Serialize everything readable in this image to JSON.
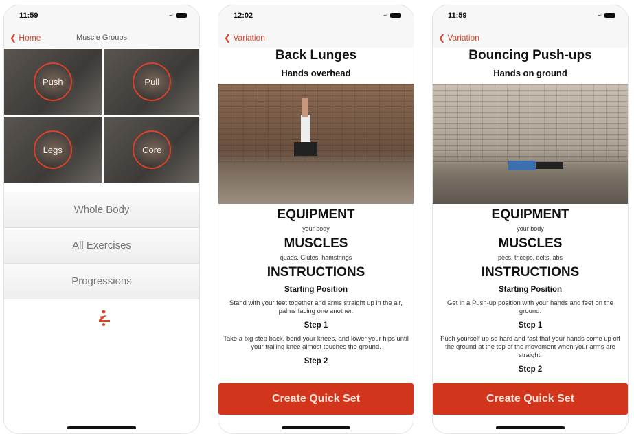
{
  "screens": [
    {
      "time": "11:59",
      "back": "Home",
      "title": "Muscle Groups",
      "groups": [
        "Push",
        "Pull",
        "Legs",
        "Core"
      ],
      "menu": [
        "Whole Body",
        "All Exercises",
        "Progressions"
      ]
    },
    {
      "time": "12:02",
      "back": "Variation",
      "exercise": "Back Lunges",
      "variation": "Hands overhead",
      "equipment_h": "EQUIPMENT",
      "equipment": "your body",
      "muscles_h": "MUSCLES",
      "muscles": "quads, Glutes, hamstrings",
      "instructions_h": "INSTRUCTIONS",
      "start_h": "Starting Position",
      "start": "Stand with your feet together and arms straight up in the air, palms facing one another.",
      "step1_h": "Step 1",
      "step1": "Take a big step back, bend your knees, and lower your hips until your trailing knee almost touches the ground.",
      "step2_h": "Step 2",
      "cta": "Create Quick Set"
    },
    {
      "time": "11:59",
      "back": "Variation",
      "exercise": "Bouncing Push-ups",
      "variation": "Hands on ground",
      "equipment_h": "EQUIPMENT",
      "equipment": "your body",
      "muscles_h": "MUSCLES",
      "muscles": "pecs, triceps, delts, abs",
      "instructions_h": "INSTRUCTIONS",
      "start_h": "Starting Position",
      "start": "Get in a Push-up position with your hands and feet on the ground.",
      "step1_h": "Step 1",
      "step1": "Push yourself up so hard and fast that your hands come up off the ground at the top of the movement when your arms are straight.",
      "step2_h": "Step 2",
      "cta": "Create Quick Set"
    }
  ],
  "colors": {
    "accent": "#d9432a",
    "button": "#d1351b"
  }
}
